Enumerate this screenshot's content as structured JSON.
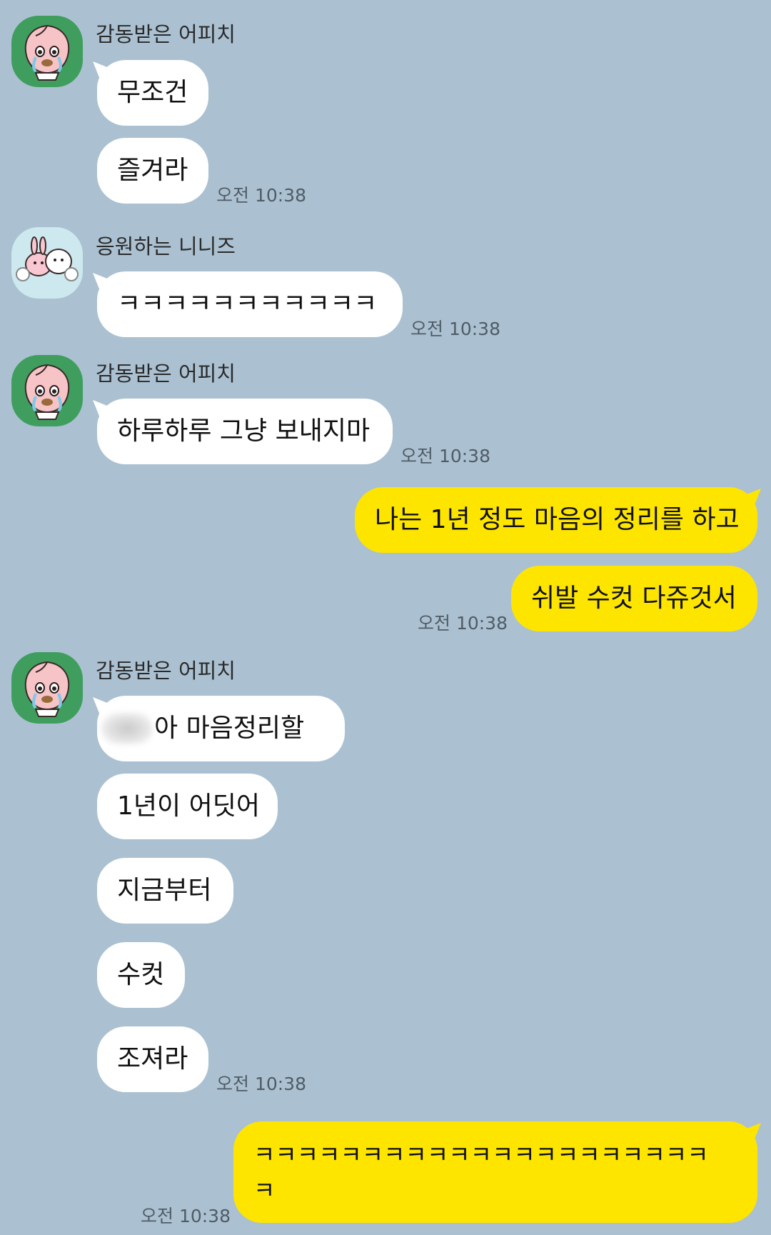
{
  "senders": {
    "apeach": "감동받은 어피치",
    "niniz": "응원하는 니니즈"
  },
  "messages": {
    "m1": "무조건",
    "m2": "즐겨라",
    "t1": "오전 10:38",
    "m3": "ㅋㅋㅋㅋㅋㅋㅋㅋㅋㅋㅋ",
    "t2": "오전 10:38",
    "m4": "하루하루 그냥 보내지마",
    "t3": "오전 10:38",
    "m5": "나는 1년 정도 마음의 정리를 하고",
    "m6": "쉬발 수컷 다쥬것서",
    "t4": "오전 10:38",
    "m7": "아 마음정리할",
    "m8": "1년이 어딧어",
    "m9": "지금부터",
    "m10": "수컷",
    "m11": "조져라",
    "t5": "오전 10:38",
    "m12": "ㅋㅋㅋㅋㅋㅋㅋㅋㅋㅋㅋㅋㅋㅋㅋㅋㅋㅋㅋㅋㅋ",
    "m12b": "ㅋ",
    "t6": "오전 10:38"
  },
  "colors": {
    "background": "#abc1d1",
    "my_bubble": "#fee500",
    "their_bubble": "#ffffff"
  },
  "icons": {
    "apeach": "apeach-crying-avatar",
    "niniz": "niniz-cheering-avatar"
  }
}
